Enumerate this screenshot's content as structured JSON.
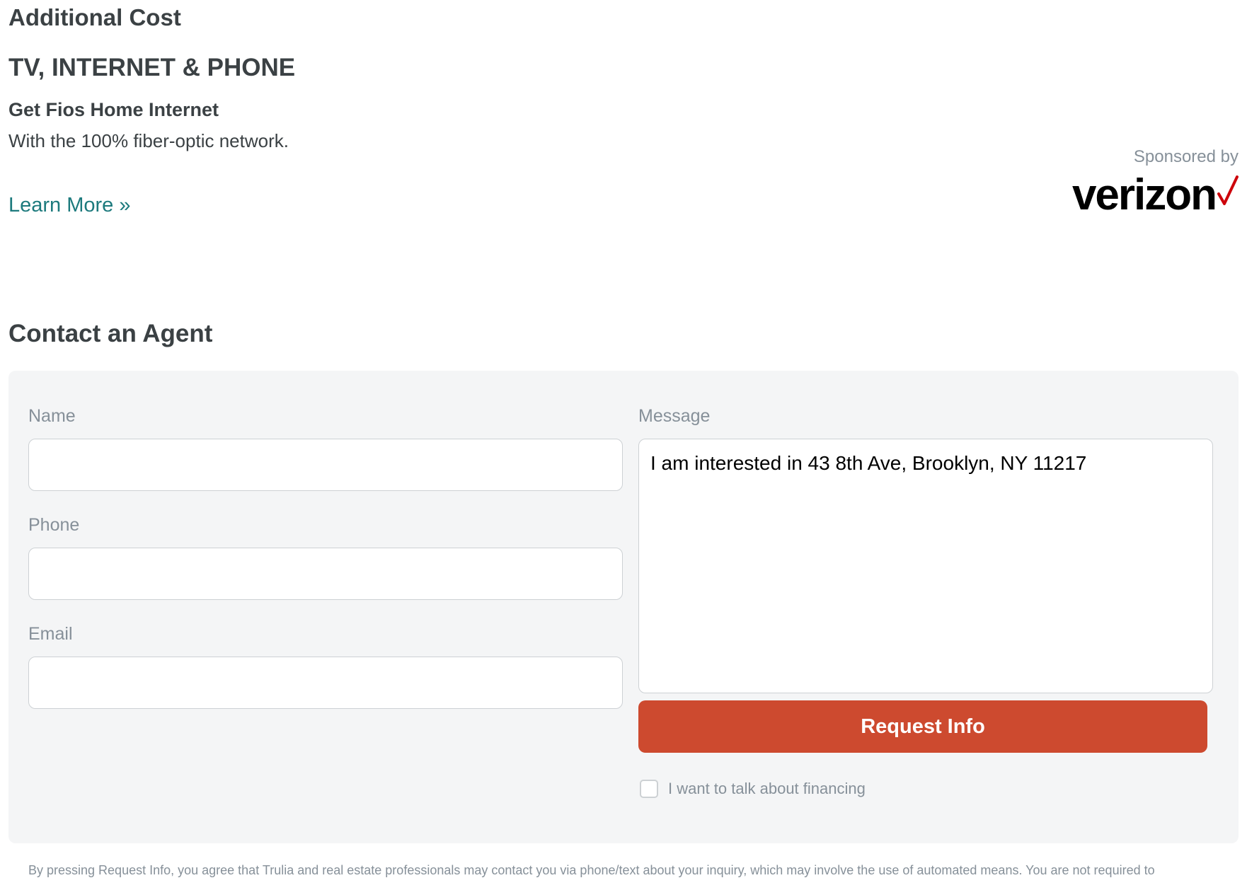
{
  "additional_cost": {
    "title": "Additional Cost"
  },
  "ad": {
    "heading": "TV, INTERNET & PHONE",
    "subheading": "Get Fios Home Internet",
    "body": "With the 100% fiber-optic network.",
    "link_label": "Learn More »",
    "sponsor_label": "Sponsored by",
    "sponsor_logo_text": "verizon",
    "sponsor_logo_check_color": "#cd040b"
  },
  "contact": {
    "title": "Contact an Agent",
    "name_label": "Name",
    "name_value": "",
    "phone_label": "Phone",
    "phone_value": "",
    "email_label": "Email",
    "email_value": "",
    "message_label": "Message",
    "message_value": "I am interested in 43 8th Ave, Brooklyn, NY 11217",
    "submit_label": "Request Info",
    "submit_color": "#cd4a2f",
    "financing_label": "I want to talk about financing",
    "financing_checked": false
  },
  "disclaimer": {
    "text": "By pressing Request Info, you agree that Trulia and real estate professionals may contact you via phone/text about your inquiry, which may involve the use of automated means. You are not required to"
  },
  "colors": {
    "link": "#1d7a7d",
    "heading": "#3b4144",
    "muted": "#869099",
    "card_background": "#f4f5f6"
  }
}
